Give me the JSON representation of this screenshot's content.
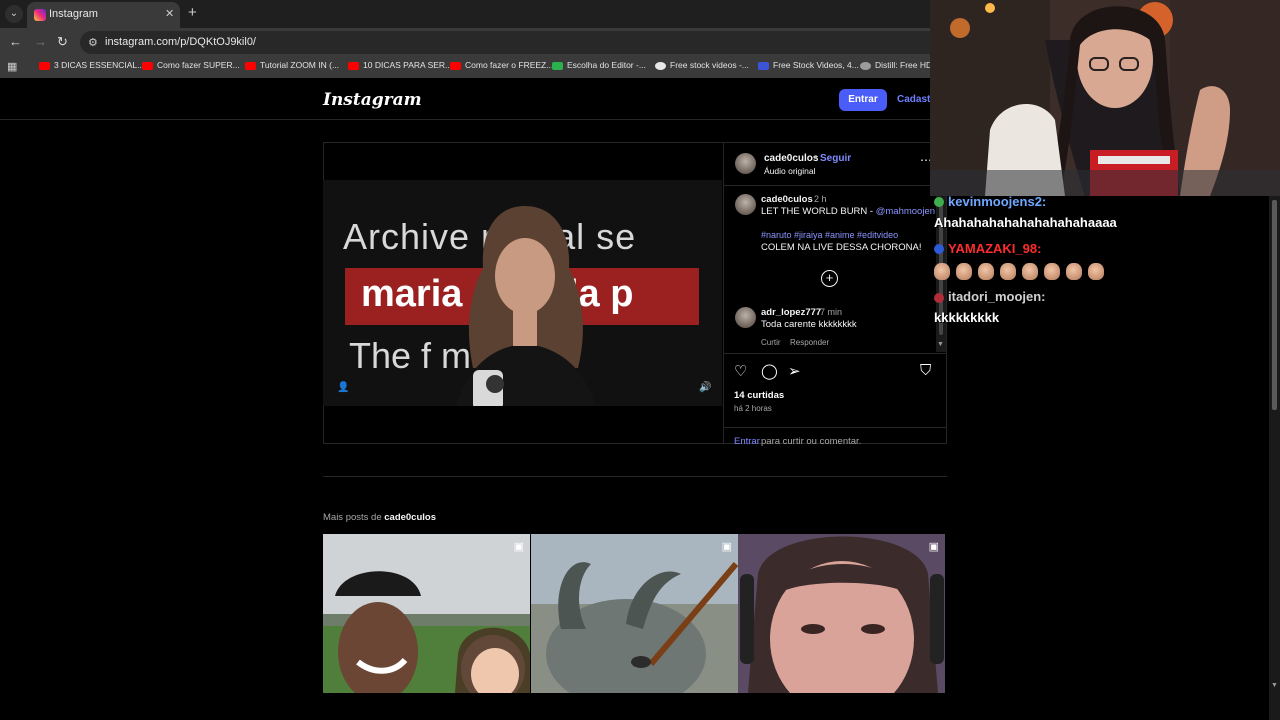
{
  "browser": {
    "tab_title": "Instagram",
    "url": "instagram.com/p/DQKtOJ9kil0/",
    "bookmarks": [
      {
        "label": "3 DICAS ESSENCIAL...",
        "icon": "youtube-icon"
      },
      {
        "label": "Como fazer SUPER...",
        "icon": "youtube-icon"
      },
      {
        "label": "Tutorial ZOOM IN (...",
        "icon": "youtube-icon"
      },
      {
        "label": "10 DICAS PARA SER...",
        "icon": "youtube-icon"
      },
      {
        "label": "Como fazer o FREEZ...",
        "icon": "youtube-icon"
      },
      {
        "label": "Escolha do Editor -...",
        "icon": "px-icon"
      },
      {
        "label": "Free stock videos -...",
        "icon": "pexels-icon"
      },
      {
        "label": "Free Stock Videos, 4...",
        "icon": "v-icon"
      },
      {
        "label": "Distill: Free HD S",
        "icon": "distill-icon"
      }
    ]
  },
  "instagram": {
    "logo": "Instagram",
    "login_label": "Entrar",
    "signup_label": "Cadastre",
    "post": {
      "author": "cade0culos",
      "dot": "•",
      "follow": "Seguir",
      "audio": "Áudio original",
      "video_text": {
        "line1": "Archive reveal se",
        "line2": "maria duarda p",
        "line3": "The        f ma"
      },
      "caption": {
        "author": "cade0culos",
        "time": "2 h",
        "text": "LET THE WORLD BURN - ",
        "mention": "@mahmoojen",
        "tags": "#naruto #jiraiya #anime #editvideo",
        "extra": "COLEM NA LIVE DESSA CHORONA!"
      },
      "comment": {
        "author": "adr_lopez777",
        "time": "7 min",
        "text": "Toda carente kkkkkkkk",
        "like": "Curtir",
        "reply": "Responder"
      },
      "likes": "14 curtidas",
      "posted": "há 2 horas",
      "login_prompt_link": "Entrar",
      "login_prompt_rest": "para curtir ou comentar."
    },
    "more_posts_prefix": "Mais posts de ",
    "more_posts_user": "cade0culos"
  },
  "chat": {
    "messages": [
      {
        "user": "kevinmoojens2:",
        "color": "#6fa8ff",
        "text": "Ahahahahahahahahahahaaaa"
      },
      {
        "user": "YAMAZAKI_98:",
        "color": "#ff2d2d",
        "text": ""
      },
      {
        "user": "itadori_moojen:",
        "color": "#d0d0d0",
        "text": "kkkkkkkkk"
      }
    ]
  },
  "colors": {
    "accent": "#4a5df9",
    "link": "#7f8cff",
    "background": "#000000"
  }
}
